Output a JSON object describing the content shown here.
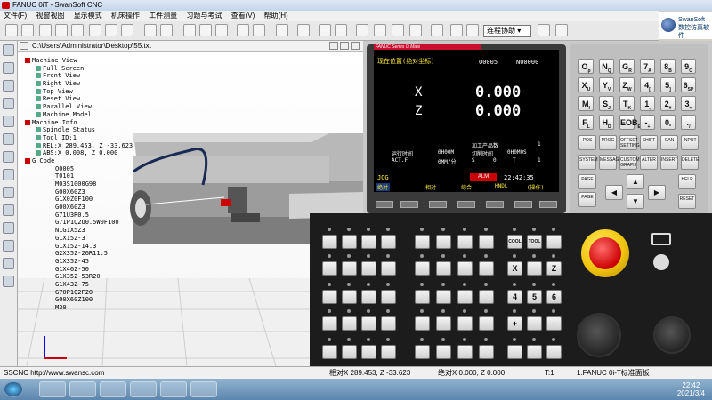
{
  "window": {
    "title": "FANUC 0iT - SwanSoft CNC"
  },
  "menu": [
    "文件(F)",
    "视窗视图",
    "显示模式",
    "机床操作",
    "工件测量",
    "习题与考试",
    "查看(V)",
    "帮助(H)"
  ],
  "toolbar": {
    "mode_select": "连程协助"
  },
  "brand": {
    "line1": "SwanSoft",
    "line2": "数控仿真软件"
  },
  "view3d": {
    "path": "C:\\Users\\Administrator\\Desktop\\55.txt"
  },
  "tree": [
    "Machine View",
    "Full Screen",
    "Front View",
    "Right View",
    "Top View",
    "Reset View",
    "Parallel View",
    "Machine Model",
    "Machine Info",
    "Spindle Status",
    "Tool ID:1",
    "REL:X  289.453, Z  -33.623",
    "ABS:X     0.008, Z     0.000",
    "G Code",
    "O0005",
    "T0101",
    "M03S1000G98",
    "G00X60Z3",
    "G1X0Z0F100",
    "G00X60Z3",
    "G71U3R0.5",
    "G71P1Q2U0.5W0F100",
    "N1G1X5Z3",
    "G1X15Z-3",
    "G1X15Z-14.3",
    "G2X35Z-26R11.5",
    "G1X35Z-45",
    "G1X46Z-50",
    "G1X35Z-53R20",
    "G1X43Z-75",
    "G70P1Q2F20",
    "G00X60Z100",
    "M30"
  ],
  "cnc": {
    "series": "FANUC Series 0i Mate",
    "screen_title": "现在位置(绝对坐标)",
    "program_no": "O0005",
    "seq_no": "N00000",
    "axes": [
      {
        "label": "X",
        "value": "0.000"
      },
      {
        "label": "Z",
        "value": "0.000"
      }
    ],
    "parts_label": "加工产品数",
    "parts_count": "1",
    "run_time_label": "运行时间",
    "run_time": "0H00M",
    "cycle_time_label": "切削时间",
    "cycle_time": "0H0M0S",
    "actf_label": "ACT.F",
    "actf": "0MM/分",
    "actf_s": "S",
    "actf_s_val": "0",
    "actf_t": "T",
    "actf_t_val": "1",
    "mode": "JOG",
    "alarm": "ALM",
    "time": "22:42:35",
    "softkeys": [
      "绝对",
      "相对",
      "综合",
      "HNDL",
      "(操作)"
    ]
  },
  "keypad": {
    "keys": [
      [
        "O",
        "p"
      ],
      [
        "N",
        "Q"
      ],
      [
        "G",
        "R"
      ],
      [
        "7",
        "A"
      ],
      [
        "8",
        "B"
      ],
      [
        "9",
        "C"
      ],
      [
        "X",
        "U"
      ],
      [
        "Y",
        "V"
      ],
      [
        "Z",
        "W"
      ],
      [
        "4",
        "["
      ],
      [
        "5",
        "]"
      ],
      [
        "6",
        "SP"
      ],
      [
        "M",
        "I"
      ],
      [
        "S",
        "J"
      ],
      [
        "T",
        "K"
      ],
      [
        "1",
        ","
      ],
      [
        "2",
        "#"
      ],
      [
        "3",
        "="
      ],
      [
        "F",
        "L"
      ],
      [
        "H",
        "D"
      ],
      [
        "EOB",
        "E"
      ],
      [
        "-",
        "+"
      ],
      [
        "0",
        "*"
      ],
      [
        ".",
        "/"
      ]
    ],
    "func_row1": [
      "POS",
      "PROG",
      "OFFSET SETTING",
      "SHIFT",
      "CAN",
      "INPUT"
    ],
    "func_row2": [
      "SYSTEM",
      "MESSAGE",
      "CUSTOM GRAPH",
      "ALTER",
      "INSERT",
      "DELETE"
    ],
    "page_up": "PAGE",
    "page_down": "PAGE",
    "help": "HELP",
    "reset": "RESET"
  },
  "opanel": {
    "axis_x": "X",
    "axis_z": "Z",
    "num4": "4",
    "num5": "5",
    "num6": "6",
    "plus": "+",
    "minus": "-",
    "cool": "COOL",
    "tool": "TOOL"
  },
  "status": {
    "left": "SSCNC  http://www.swansc.com",
    "rel": "相对X  289.453, Z  -33.623",
    "abs": "绝对X  0.000, Z  0.000",
    "t": "T:1",
    "machine": "1.FANUC 0i-T标准面板"
  },
  "clock": {
    "time": "22:42",
    "date": "2021/3/4"
  }
}
